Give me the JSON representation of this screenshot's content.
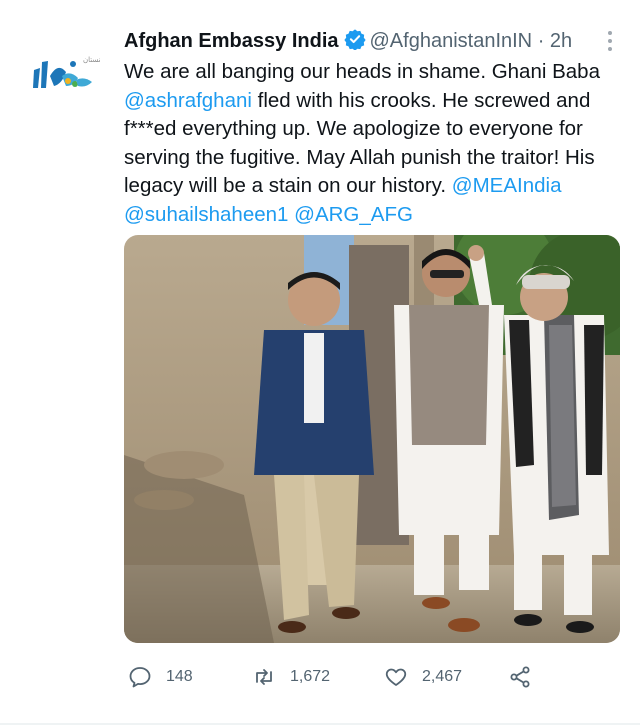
{
  "tweet": {
    "display_name": "Afghan Embassy India",
    "handle": "@AfghanistanInIN",
    "separator": "·",
    "time": "2h",
    "avatar_text": "سفارت افغانستان",
    "body": {
      "line1": "We are all banging our heads in shame. Ghani Baba",
      "mention1": "@ashrafghani",
      "text2": " fled with his crooks. He screwed and f***ed everything up. We apologize to everyone for serving the fugitive. May Allah punish the traitor! His legacy will be a stain on our history. ",
      "mention2": "@MEAIndia",
      "mention3": "@suhailshaheen1",
      "space": " ",
      "mention4": "@ARG_AFG"
    },
    "actions": {
      "replies": "148",
      "retweets": "1,672",
      "likes": "2,467"
    },
    "colors": {
      "accent": "#1d9bf0",
      "text": "#0f1419",
      "muted": "#536471"
    }
  }
}
